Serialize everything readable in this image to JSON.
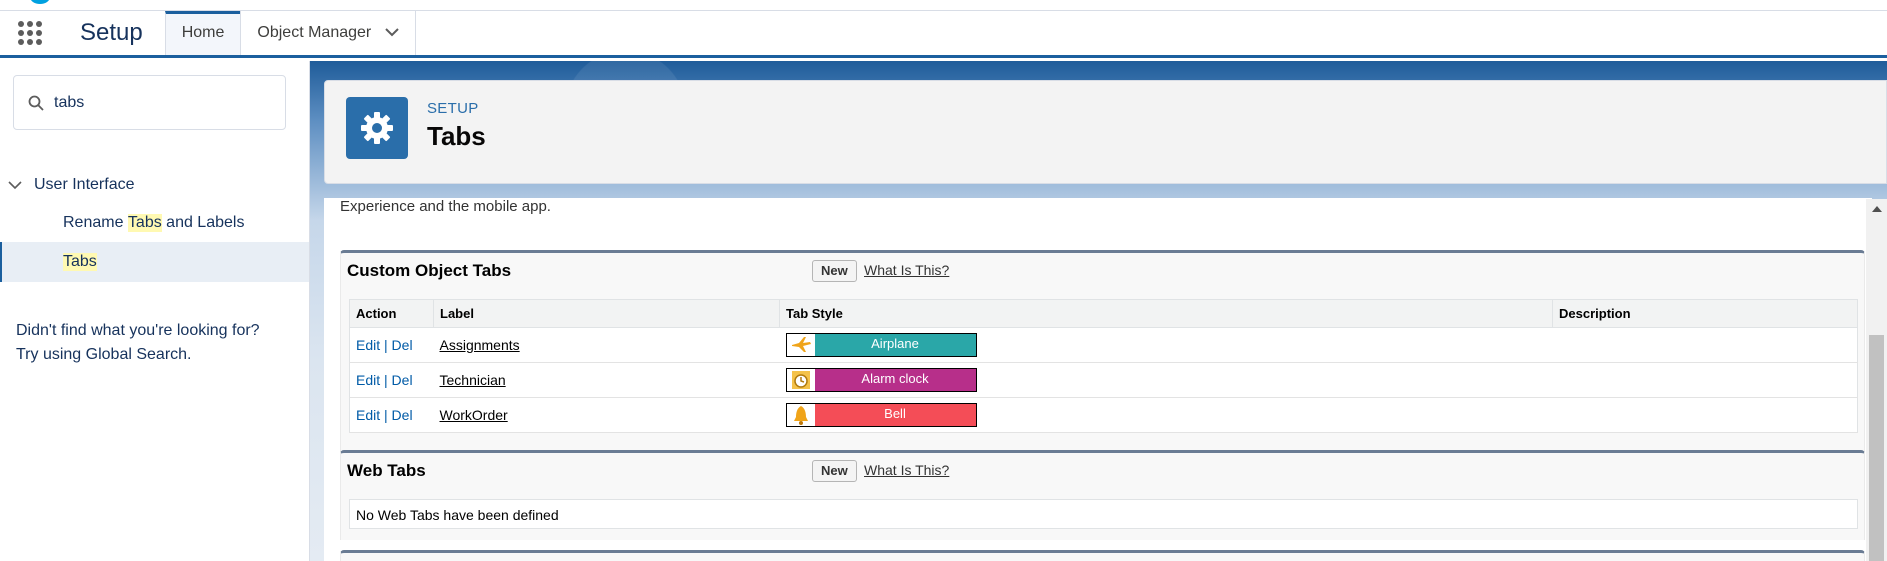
{
  "nav": {
    "app_name": "Setup",
    "tabs": [
      {
        "label": "Home"
      },
      {
        "label": "Object Manager"
      }
    ]
  },
  "sidebar": {
    "search_value": "tabs",
    "tree_head": "User Interface",
    "items": [
      {
        "pre": "Rename ",
        "hl": "Tabs",
        "post": " and Labels"
      },
      {
        "pre": "",
        "hl": "Tabs",
        "post": ""
      }
    ],
    "not_found_line1": "Didn't find what you're looking for?",
    "not_found_line2": "Try using Global Search."
  },
  "header": {
    "breadcrumb": "SETUP",
    "title": "Tabs"
  },
  "content": {
    "intro": "Experience and the mobile app.",
    "custom_object_tabs": {
      "title": "Custom Object Tabs",
      "new_label": "New",
      "help_label": "What Is This?",
      "columns": [
        "Action",
        "Label",
        "Tab Style",
        "Description"
      ],
      "edit_label": "Edit",
      "sep": " | ",
      "del_label": "Del",
      "rows": [
        {
          "label": "Assignments",
          "style": "Airplane",
          "color": "#2aa7a8",
          "icon": "airplane-icon",
          "description": ""
        },
        {
          "label": "Technician",
          "style": "Alarm clock",
          "color": "#b72f8a",
          "icon": "alarm-clock-icon",
          "description": ""
        },
        {
          "label": "WorkOrder",
          "style": "Bell",
          "color": "#f44d57",
          "icon": "bell-icon",
          "description": ""
        }
      ]
    },
    "web_tabs": {
      "title": "Web Tabs",
      "new_label": "New",
      "help_label": "What Is This?",
      "empty_text": "No Web Tabs have been defined"
    }
  }
}
